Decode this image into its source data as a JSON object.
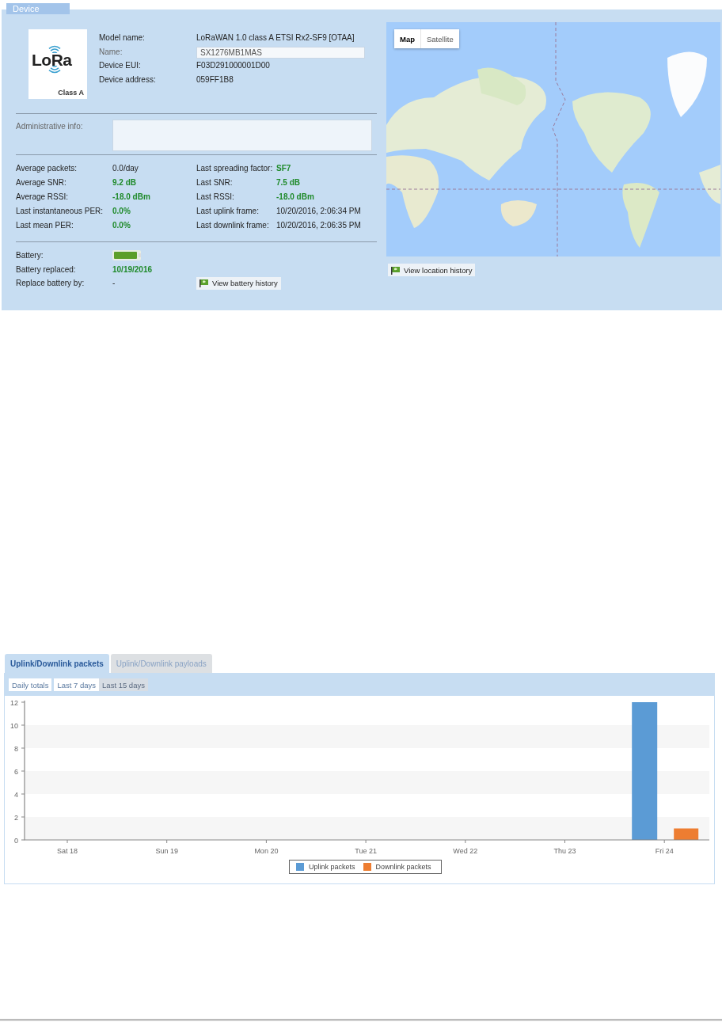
{
  "panel": {
    "title": "Device"
  },
  "device": {
    "logo_text": "LoRa",
    "class_label": "Class A",
    "fields": [
      {
        "label": "Model name:",
        "value": "LoRaWAN 1.0 class A ETSI Rx2-SF9 [OTAA]",
        "kind": "text"
      },
      {
        "label": "Name:",
        "value": "SX1276MB1MAS",
        "kind": "input"
      },
      {
        "label": "Device EUI:",
        "value": "F03D291000001D00",
        "kind": "text"
      },
      {
        "label": "Device address:",
        "value": "059FF1B8",
        "kind": "text"
      }
    ]
  },
  "admin": {
    "label": "Administrative info:"
  },
  "stats": [
    {
      "label": "Average packets:",
      "value": "0.0/day",
      "highlighted": false
    },
    {
      "label": "Last spreading factor:",
      "value": "SF7",
      "highlighted": true
    },
    {
      "label": "Average SNR:",
      "value": "9.2 dB",
      "highlighted": true
    },
    {
      "label": "Last SNR:",
      "value": "7.5 dB",
      "highlighted": true
    },
    {
      "label": "Average RSSI:",
      "value": "-18.0 dBm",
      "highlighted": true
    },
    {
      "label": "Last RSSI:",
      "value": "-18.0 dBm",
      "highlighted": true
    },
    {
      "label": "Last instantaneous PER:",
      "value": "0.0%",
      "highlighted": true
    },
    {
      "label": "Last uplink frame:",
      "value": "10/20/2016, 2:06:34 PM",
      "highlighted": false
    },
    {
      "label": "Last mean PER:",
      "value": "0.0%",
      "highlighted": true
    },
    {
      "label": "Last downlink frame:",
      "value": "10/20/2016, 2:06:35 PM",
      "highlighted": false
    }
  ],
  "battery": {
    "label": "Battery:",
    "replaced_label": "Battery replaced:",
    "replaced_value": "10/19/2016",
    "replace_by_label": "Replace battery by:",
    "replace_by_value": "-",
    "history_button": "View battery history"
  },
  "map": {
    "kind": "picture",
    "map_types": [
      {
        "label": "Map",
        "selected": true
      },
      {
        "label": "Satellite",
        "selected": false
      }
    ],
    "history_button": "View location history"
  },
  "chart_tabs": [
    {
      "label": "Uplink/Downlink packets",
      "selected": true
    },
    {
      "label": "Uplink/Downlink payloads",
      "selected": false
    }
  ],
  "ranges": [
    {
      "label": "Daily totals",
      "selected": false
    },
    {
      "label": "Last 7 days",
      "selected": false
    },
    {
      "label": "Last 15 days",
      "selected": true
    }
  ],
  "chart": {
    "chart_data": {
      "type": "bar",
      "categories": [
        "Sat 18",
        "Sun 19",
        "Mon 20",
        "Tue 21",
        "Wed 22",
        "Thu 23",
        "Fri 24"
      ],
      "series": [
        {
          "name": "Uplink packets",
          "color": "#5b9bd5",
          "values": [
            0,
            0,
            0,
            0,
            0,
            0,
            12
          ]
        },
        {
          "name": "Downlink packets",
          "color": "#ed7d31",
          "values": [
            0,
            0,
            0,
            0,
            0,
            0,
            1
          ]
        }
      ],
      "ylim": [
        0,
        12
      ],
      "yticks": [
        0,
        2,
        4,
        6,
        8,
        10,
        12
      ],
      "legend": "bottom"
    }
  }
}
